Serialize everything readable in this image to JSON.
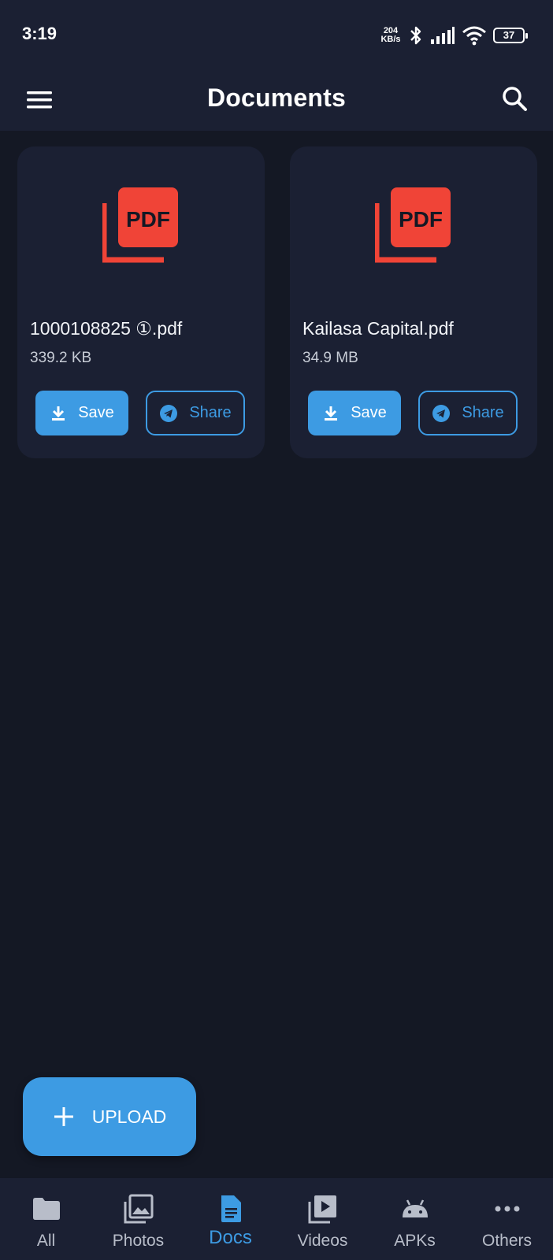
{
  "status_bar": {
    "time": "3:19",
    "net_speed_value": "204",
    "net_speed_unit": "KB/s",
    "battery": "37",
    "icons": [
      "bluetooth-icon",
      "signal-icon",
      "wifi-icon",
      "battery-icon"
    ]
  },
  "app_bar": {
    "title": "Documents",
    "menu_icon": "hamburger-menu-icon",
    "search_icon": "search-icon"
  },
  "files": [
    {
      "name": "1000108825 ①.pdf",
      "size": "339.2 KB",
      "save_label": "Save",
      "share_label": "Share",
      "icon": "pdf-icon"
    },
    {
      "name": "Kailasa Capital.pdf",
      "size": "34.9 MB",
      "save_label": "Save",
      "share_label": "Share",
      "icon": "pdf-icon"
    }
  ],
  "fab": {
    "label": "UPLOAD",
    "icon": "plus-icon"
  },
  "bottom_nav": {
    "items": [
      {
        "label": "All",
        "icon": "folder-icon"
      },
      {
        "label": "Photos",
        "icon": "photos-icon"
      },
      {
        "label": "Docs",
        "icon": "document-icon",
        "active": true
      },
      {
        "label": "Videos",
        "icon": "video-icon"
      },
      {
        "label": "APKs",
        "icon": "android-icon"
      },
      {
        "label": "Others",
        "icon": "more-dots-icon"
      }
    ]
  },
  "colors": {
    "background": "#141824",
    "surface": "#1b2033",
    "accent": "#3d9be3",
    "pdf_red": "#f04437"
  }
}
